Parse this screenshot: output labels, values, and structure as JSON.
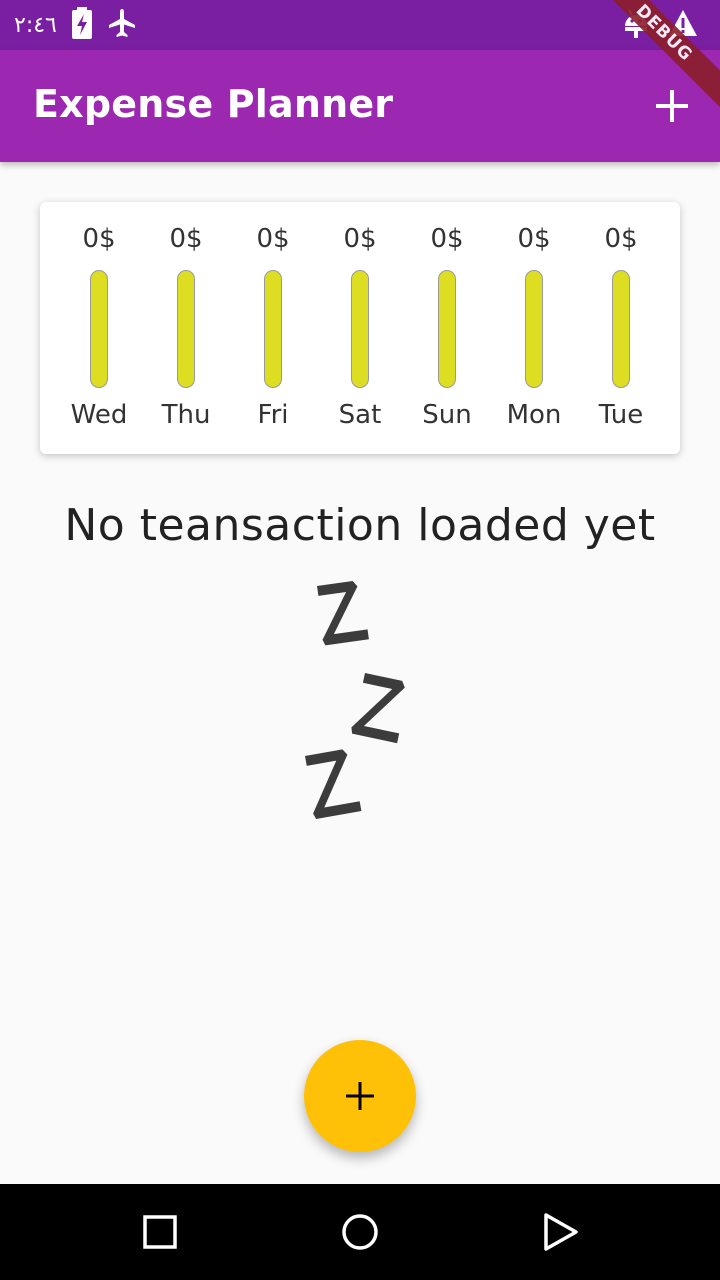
{
  "status_bar": {
    "time": "٢:٤٦",
    "icons": [
      "battery-charging-icon",
      "airplane-mode-icon",
      "android-debug-icon",
      "warning-icon"
    ]
  },
  "app_bar": {
    "title": "Expense Planner",
    "add_icon": "plus-icon",
    "debug_banner": "DEBUG"
  },
  "chart": {
    "days": [
      {
        "label": "Wed",
        "amount": "0$",
        "fill_fraction": 0
      },
      {
        "label": "Thu",
        "amount": "0$",
        "fill_fraction": 0
      },
      {
        "label": "Fri",
        "amount": "0$",
        "fill_fraction": 0
      },
      {
        "label": "Sat",
        "amount": "0$",
        "fill_fraction": 0
      },
      {
        "label": "Sun",
        "amount": "0$",
        "fill_fraction": 0
      },
      {
        "label": "Mon",
        "amount": "0$",
        "fill_fraction": 0
      },
      {
        "label": "Tue",
        "amount": "0$",
        "fill_fraction": 0
      }
    ]
  },
  "empty_state": {
    "message": "No teansaction loaded yet",
    "image": "sleeping-zzz-icon"
  },
  "fab": {
    "icon": "plus-icon"
  },
  "nav_bar": {
    "buttons": [
      "recents-square-icon",
      "home-circle-icon",
      "back-triangle-icon"
    ]
  },
  "colors": {
    "status_bar": "#7b1fa2",
    "primary": "#9c27b0",
    "bar_empty": "#dddd22",
    "fab": "#ffc107"
  }
}
